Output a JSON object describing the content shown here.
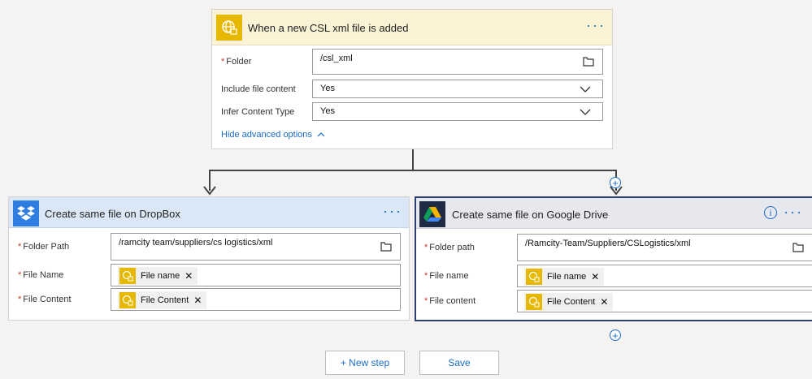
{
  "trigger": {
    "title": "When a new CSL xml file is added",
    "folder_label": "Folder",
    "folder_value": "/csl_xml",
    "include_label": "Include file content",
    "include_value": "Yes",
    "infer_label": "Infer Content Type",
    "infer_value": "Yes",
    "advanced_link": "Hide advanced options",
    "more": "···",
    "icon": "globe-sftp-icon",
    "accent": "#e6b800"
  },
  "dropbox": {
    "title": "Create same file on DropBox",
    "folder_label": "Folder Path",
    "folder_value": "/ramcity team/suppliers/cs logistics/xml",
    "name_label": "File Name",
    "name_token": "File name",
    "content_label": "File Content",
    "content_token": "File Content",
    "more": "···",
    "icon": "dropbox-icon",
    "accent": "#2e7de1"
  },
  "gdrive": {
    "title": "Create same file on Google Drive",
    "folder_label": "Folder path",
    "folder_value": "/Ramcity-Team/Suppliers/CSLogistics/xml",
    "name_label": "File name",
    "name_token": "File name",
    "content_label": "File content",
    "content_token": "File Content",
    "more": "···",
    "info": "i",
    "icon": "google-drive-icon"
  },
  "footer": {
    "new_step": "+ New step",
    "save": "Save"
  },
  "token_close": "✕",
  "required_mark": "*"
}
